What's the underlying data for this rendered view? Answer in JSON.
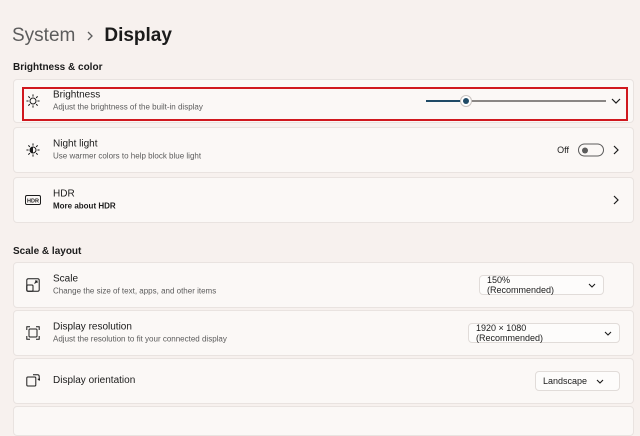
{
  "breadcrumb": {
    "parent": "System",
    "current": "Display"
  },
  "sections": {
    "brightness_color": "Brightness & color",
    "scale_layout": "Scale & layout"
  },
  "brightness": {
    "title": "Brightness",
    "subtitle": "Adjust the brightness of the built-in display",
    "level_fraction": 0.22
  },
  "night_light": {
    "title": "Night light",
    "subtitle": "Use warmer colors to help block blue light",
    "state_label": "Off"
  },
  "hdr": {
    "icon_text": "HDR",
    "title": "HDR",
    "subtitle": "More about HDR"
  },
  "scale": {
    "title": "Scale",
    "subtitle": "Change the size of text, apps, and other items",
    "value": "150% (Recommended)"
  },
  "resolution": {
    "title": "Display resolution",
    "subtitle": "Adjust the resolution to fit your connected display",
    "value": "1920 × 1080 (Recommended)"
  },
  "orientation": {
    "title": "Display orientation",
    "value": "Landscape"
  },
  "colors": {
    "accent": "#1f4a66",
    "highlight": "#d0181e"
  }
}
